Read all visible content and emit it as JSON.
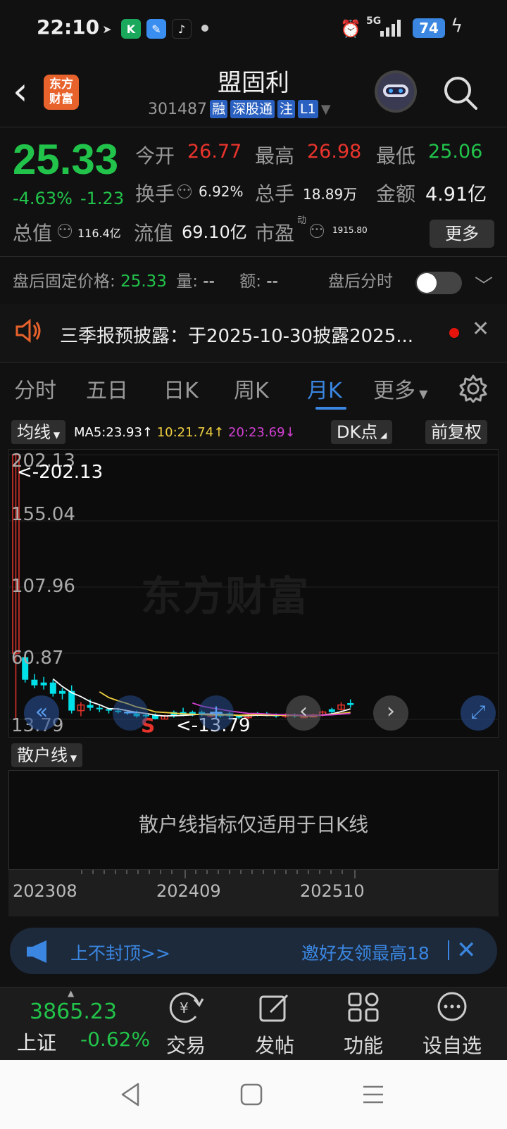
{
  "status_bar": {
    "time": "22:10",
    "network": "5G",
    "battery": "74"
  },
  "header": {
    "logo_line1": "东方",
    "logo_line2": "财富",
    "stock_name": "盟固利",
    "stock_code": "301487",
    "tags": [
      "融",
      "深股通",
      "注",
      "L1"
    ]
  },
  "quote": {
    "price": "25.33",
    "change_pct": "-4.63%",
    "change": "-1.23",
    "open_label": "今开",
    "open": "26.77",
    "high_label": "最高",
    "high": "26.98",
    "low_label": "最低",
    "low": "25.06",
    "turnover_label": "换手",
    "turnover": "6.92%",
    "volume_label": "总手",
    "volume": "18.89万",
    "amount_label": "金额",
    "amount": "4.91亿",
    "mktcap_label": "总值",
    "mktcap": "116.4亿",
    "float_label": "流值",
    "float_cap": "69.10亿",
    "pe_label": "市盈",
    "pe_super": "动",
    "pe": "1915.80",
    "more_label": "更多"
  },
  "after_hours": {
    "label": "盘后固定价格:",
    "price": "25.33",
    "vol_label": "量:",
    "vol": "--",
    "amt_label": "额:",
    "amt": "--",
    "intraday_label": "盘后分时"
  },
  "news": {
    "text": "三季报预披露：于2025-10-30披露2025..."
  },
  "tabs": [
    "分时",
    "五日",
    "日K",
    "周K",
    "月K",
    "更多"
  ],
  "active_tab": "月K",
  "ma": {
    "selector": "均线",
    "ma5": "MA5:23.93",
    "ma10": "10:21.74",
    "ma20": "20:23.69",
    "dk_label": "DK点",
    "adjust_label": "前复权",
    "colors": {
      "ma5": "#ffffff",
      "ma10": "#f0d040",
      "ma20": "#d040d0"
    }
  },
  "chart_data": {
    "type": "candlestick",
    "y_ticks": [
      "202.13",
      "155.04",
      "107.96",
      "60.87",
      "13.79"
    ],
    "max_label": "<-202.13",
    "min_label": "<-13.79",
    "x_labels": [
      "202308",
      "202409",
      "202510"
    ],
    "sell_marker": "S",
    "watermark": "东方财富",
    "ylim": [
      13.79,
      202.13
    ],
    "candles": [
      {
        "o": 202.13,
        "h": 202.13,
        "l": 13.79,
        "c": 60.87,
        "up": true
      },
      {
        "o": 58,
        "h": 62,
        "l": 40,
        "c": 42,
        "up": false
      },
      {
        "o": 42,
        "h": 46,
        "l": 36,
        "c": 38,
        "up": false
      },
      {
        "o": 38,
        "h": 44,
        "l": 35,
        "c": 40,
        "up": false
      },
      {
        "o": 40,
        "h": 42,
        "l": 30,
        "c": 32,
        "up": false
      },
      {
        "o": 32,
        "h": 36,
        "l": 28,
        "c": 34,
        "up": false
      },
      {
        "o": 34,
        "h": 38,
        "l": 18,
        "c": 20,
        "up": false
      },
      {
        "o": 20,
        "h": 26,
        "l": 16,
        "c": 24,
        "up": true
      },
      {
        "o": 24,
        "h": 28,
        "l": 20,
        "c": 22,
        "up": false
      },
      {
        "o": 22,
        "h": 24,
        "l": 19,
        "c": 21,
        "up": false
      },
      {
        "o": 21,
        "h": 22,
        "l": 18,
        "c": 20,
        "up": false
      },
      {
        "o": 20,
        "h": 22,
        "l": 18,
        "c": 19,
        "up": false
      },
      {
        "o": 19,
        "h": 20,
        "l": 17,
        "c": 18,
        "up": false
      },
      {
        "o": 18,
        "h": 20,
        "l": 15,
        "c": 16,
        "up": false
      },
      {
        "o": 16,
        "h": 18,
        "l": 14,
        "c": 17,
        "up": false
      },
      {
        "o": 17,
        "h": 18,
        "l": 13.79,
        "c": 14,
        "up": false
      },
      {
        "o": 14,
        "h": 17,
        "l": 13.8,
        "c": 16,
        "up": true
      },
      {
        "o": 16,
        "h": 20,
        "l": 15,
        "c": 19,
        "up": false
      },
      {
        "o": 19,
        "h": 22,
        "l": 16,
        "c": 17,
        "up": false
      },
      {
        "o": 17,
        "h": 20,
        "l": 16,
        "c": 19,
        "up": false
      },
      {
        "o": 19,
        "h": 20,
        "l": 16,
        "c": 17,
        "up": false
      },
      {
        "o": 17,
        "h": 18,
        "l": 15,
        "c": 16,
        "up": true
      },
      {
        "o": 16,
        "h": 19,
        "l": 15,
        "c": 18,
        "up": false
      },
      {
        "o": 18,
        "h": 19,
        "l": 15,
        "c": 16,
        "up": false
      },
      {
        "o": 16,
        "h": 17,
        "l": 14,
        "c": 15,
        "up": false
      },
      {
        "o": 15,
        "h": 18,
        "l": 14,
        "c": 17,
        "up": true
      },
      {
        "o": 17,
        "h": 19,
        "l": 16,
        "c": 18,
        "up": false
      },
      {
        "o": 18,
        "h": 19,
        "l": 16,
        "c": 17,
        "up": false
      },
      {
        "o": 17,
        "h": 18,
        "l": 15,
        "c": 16,
        "up": false
      },
      {
        "o": 16,
        "h": 18,
        "l": 15,
        "c": 17,
        "up": true
      },
      {
        "o": 17,
        "h": 18,
        "l": 15,
        "c": 16,
        "up": false
      },
      {
        "o": 16,
        "h": 17,
        "l": 15,
        "c": 15.5,
        "up": true
      },
      {
        "o": 15.5,
        "h": 18,
        "l": 15,
        "c": 17,
        "up": true
      },
      {
        "o": 17,
        "h": 20,
        "l": 16,
        "c": 19,
        "up": true
      },
      {
        "o": 19,
        "h": 22,
        "l": 18,
        "c": 21,
        "up": false
      },
      {
        "o": 21,
        "h": 26,
        "l": 20,
        "c": 24,
        "up": true
      },
      {
        "o": 24,
        "h": 28,
        "l": 22,
        "c": 25.33,
        "up": false
      }
    ]
  },
  "sub_indicator": {
    "selector": "散户线",
    "message": "散户线指标仅适用于日K线"
  },
  "promo": {
    "left_text": "上不封顶>>",
    "right_text": "邀好友领最高18"
  },
  "bottom_bar": {
    "index_value": "3865.23",
    "index_name": "上证",
    "index_pct": "-0.62%",
    "items": [
      "交易",
      "发帖",
      "功能",
      "设自选"
    ]
  }
}
